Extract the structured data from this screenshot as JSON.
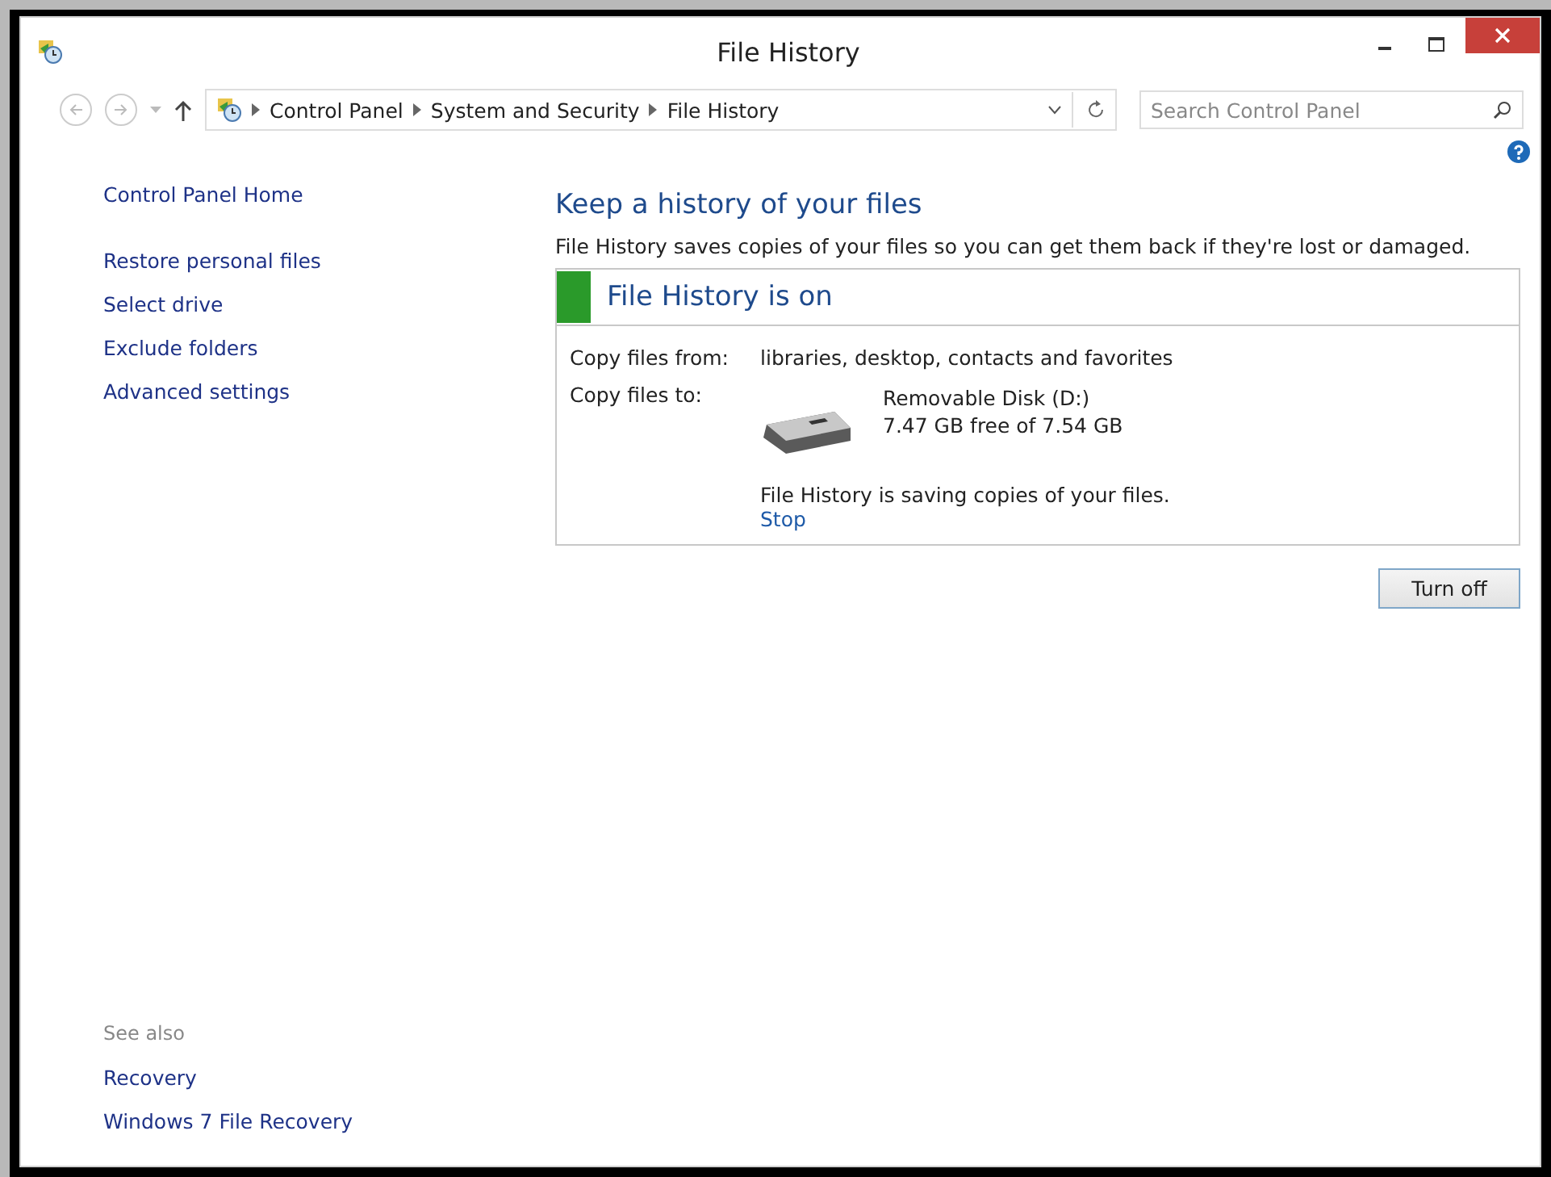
{
  "window": {
    "title": "File History"
  },
  "address_bar": {
    "back": {
      "disabled": true
    },
    "forward": {
      "disabled": true
    },
    "breadcrumbs": [
      "Control Panel",
      "System and Security",
      "File History"
    ]
  },
  "search": {
    "placeholder": "Search Control Panel"
  },
  "sidebar": {
    "items": [
      "Control Panel Home",
      "Restore personal files",
      "Select drive",
      "Exclude folders",
      "Advanced settings"
    ],
    "see_also": {
      "heading": "See also",
      "links": [
        "Recovery",
        "Windows 7 File Recovery"
      ]
    }
  },
  "main": {
    "heading": "Keep a history of your files",
    "description": "File History saves copies of your files so you can get them back if they're lost or damaged.",
    "status_panel": {
      "title": "File History is on",
      "on": true,
      "copy_from": {
        "label": "Copy files from:",
        "value": "libraries, desktop, contacts and favorites"
      },
      "copy_to": {
        "label": "Copy files to:",
        "drive_name": "Removable Disk (D:)",
        "drive_space": "7.47 GB free of 7.54 GB"
      },
      "progress": "File History is saving copies of your files.",
      "stop_link": "Stop"
    },
    "button": "Turn off"
  }
}
